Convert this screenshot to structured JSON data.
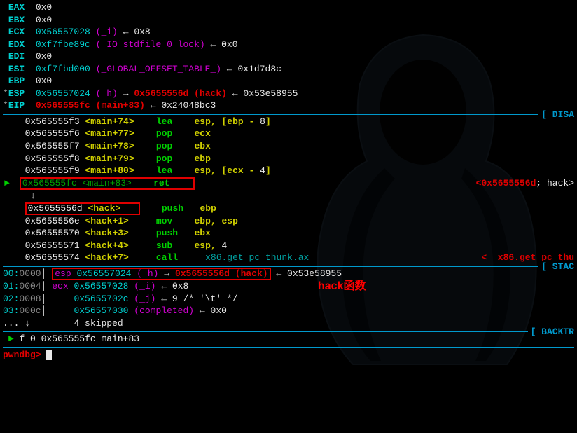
{
  "registers": [
    {
      "name": "EAX",
      "star": " ",
      "addr": "0x0",
      "sym": "",
      "chain": ""
    },
    {
      "name": "EBX",
      "star": " ",
      "addr": "0x0",
      "sym": "",
      "chain": ""
    },
    {
      "name": "ECX",
      "star": " ",
      "addr": "0x56557028",
      "sym": "(_i)",
      "arrow": "←",
      "val": "0x8"
    },
    {
      "name": "EDX",
      "star": " ",
      "addr": "0xf7fbe89c",
      "sym": "(_IO_stdfile_0_lock)",
      "arrow": "←",
      "val": "0x0"
    },
    {
      "name": "EDI",
      "star": " ",
      "addr": "0x0",
      "sym": "",
      "chain": ""
    },
    {
      "name": "ESI",
      "star": " ",
      "addr": "0xf7fbd000",
      "sym": "(_GLOBAL_OFFSET_TABLE_)",
      "arrow": "←",
      "val": "0x1d7d8c"
    },
    {
      "name": "EBP",
      "star": " ",
      "addr": "0x0",
      "sym": "",
      "chain": ""
    },
    {
      "name": "ESP",
      "star": "*",
      "addr": "0x56557024",
      "sym": "(_h)",
      "arrow": "→",
      "val2addr": "0x5655556d",
      "val2sym": "(hack)",
      "arrow2": "←",
      "val2": "0x53e58955"
    },
    {
      "name": "EIP",
      "star": "*",
      "addr": "0x565555fc",
      "sym": "(main+83)",
      "arrow": "←",
      "val": "0x24048bc3"
    }
  ],
  "sections": {
    "disasm": "[ DISA",
    "stack": "[ STAC",
    "backtrace": "[ BACKTR"
  },
  "disasm": [
    {
      "addr": "0x565555f3",
      "loc": "<main+74>",
      "mn": "lea",
      "ops_pre": "esp, [ebp - ",
      "ops_num": "8",
      "ops_post": "]"
    },
    {
      "addr": "0x565555f6",
      "loc": "<main+77>",
      "mn": "pop",
      "ops": "ecx"
    },
    {
      "addr": "0x565555f7",
      "loc": "<main+78>",
      "mn": "pop",
      "ops": "ebx"
    },
    {
      "addr": "0x565555f8",
      "loc": "<main+79>",
      "mn": "pop",
      "ops": "ebp"
    },
    {
      "addr": "0x565555f9",
      "loc": "<main+80>",
      "mn": "lea",
      "ops_pre": "esp, [ecx - ",
      "ops_num": "4",
      "ops_post": "]"
    }
  ],
  "disasm_current": {
    "addr": "0x565555fc",
    "loc": "<main+83>",
    "mn": "ret",
    "comment_pre": "<",
    "comment_addr": "0x5655556d",
    "comment_post": "; hack>"
  },
  "disasm_arrow": "↓",
  "disasm_target": {
    "addr": "0x5655556d",
    "loc": "<hack>"
  },
  "disasm_after": [
    {
      "addr": "0x5655556d",
      "loc": "",
      "mn": "push",
      "ops": "ebp",
      "in_box": true
    },
    {
      "addr": "0x5655556e",
      "loc": "<hack+1>",
      "mn": "mov",
      "ops": "ebp, esp"
    },
    {
      "addr": "0x56555570",
      "loc": "<hack+3>",
      "mn": "push",
      "ops": "ebx"
    },
    {
      "addr": "0x56555571",
      "loc": "<hack+4>",
      "mn": "sub",
      "ops_pre": "esp, ",
      "ops_num": "4"
    },
    {
      "addr": "0x56555574",
      "loc": "<hack+7>",
      "mn": "call",
      "ops_call": "__x86.get_pc_thunk.ax",
      "right": "<__x86.get_pc_thu"
    }
  ],
  "stack": [
    {
      "off1": "00:",
      "off2": "0000",
      "reg": "esp",
      "addr": "0x56557024",
      "sym": "(_h)",
      "arrow": "→",
      "val_addr": "0x5655556d",
      "val_sym": "(hack)",
      "arrow2": "←",
      "tail": "0x53e58955"
    },
    {
      "off1": "01:",
      "off2": "0004",
      "reg": "ecx",
      "addr": "0x56557028",
      "sym": "(_i)",
      "arrow": "←",
      "tail": "0x8"
    },
    {
      "off1": "02:",
      "off2": "0008",
      "reg": "",
      "addr": "0x5655702c",
      "sym": "(_j)",
      "arrow": "←",
      "tail": "9 /* '\\t' */"
    },
    {
      "off1": "03:",
      "off2": "000c",
      "reg": "",
      "addr": "0x56557030",
      "sym": "(completed)",
      "arrow": "←",
      "tail": "0x0"
    }
  ],
  "stack_ellipsis": "... ↓",
  "stack_skipped": "4 skipped",
  "backtrace": {
    "marker": "►",
    "text": "f 0 0x565555fc main+83"
  },
  "prompt": "pwndbg>",
  "annotation": "hack函数"
}
